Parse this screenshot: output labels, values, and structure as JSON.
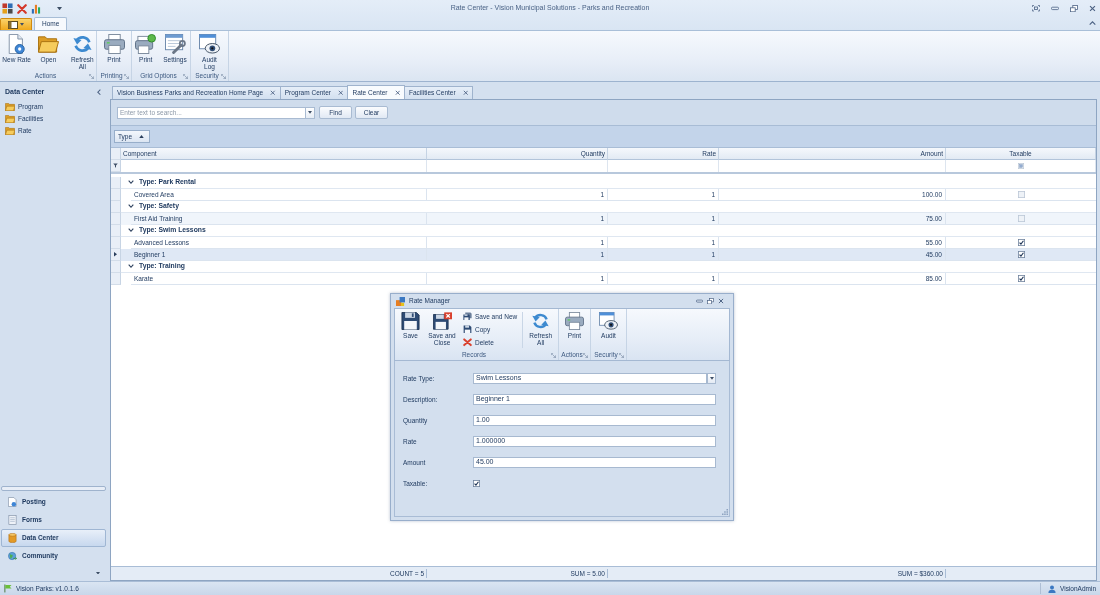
{
  "window": {
    "title": "Rate Center - Vision Municipal Solutions - Parks and Recreation"
  },
  "ribbon": {
    "tabs": [
      {
        "label": "Home",
        "selected": true
      }
    ],
    "groups": [
      {
        "label": "Actions",
        "buttons": [
          {
            "label": "New Rate"
          },
          {
            "label": "Open"
          },
          {
            "label": "Refresh All"
          }
        ]
      },
      {
        "label": "Printing",
        "buttons": [
          {
            "label": "Print"
          }
        ]
      },
      {
        "label": "Grid Options",
        "buttons": [
          {
            "label": "Print"
          },
          {
            "label": "Settings"
          }
        ]
      },
      {
        "label": "Security",
        "buttons": [
          {
            "label": "Audit Log"
          }
        ]
      }
    ]
  },
  "sidebar": {
    "title": "Data Center",
    "items": [
      {
        "label": "Program"
      },
      {
        "label": "Facilities"
      },
      {
        "label": "Rate"
      }
    ],
    "nav": [
      {
        "label": "Posting",
        "selected": false
      },
      {
        "label": "Forms",
        "selected": false
      },
      {
        "label": "Data Center",
        "selected": true
      },
      {
        "label": "Community",
        "selected": false
      }
    ]
  },
  "document_tabs": [
    {
      "label": "Vision Business Parks and Recreation Home Page",
      "selected": false
    },
    {
      "label": "Program Center",
      "selected": false
    },
    {
      "label": "Rate Center",
      "selected": true
    },
    {
      "label": "Facilities Center",
      "selected": false
    }
  ],
  "search": {
    "placeholder": "Enter text to search...",
    "buttons": [
      "Find",
      "Clear"
    ]
  },
  "group_panel": {
    "columns": [
      {
        "label": "Type",
        "ascending": true
      }
    ]
  },
  "grid": {
    "columns": [
      "Component",
      "Quantity",
      "Rate",
      "Amount",
      "Taxable"
    ],
    "filter_row": {
      "taxable_indeterminate": true
    },
    "groups": [
      {
        "label": "Type: Park Rental",
        "expanded": true,
        "rows": [
          {
            "component": "Covered Area",
            "quantity": "1",
            "rate": "1",
            "amount": "100.00",
            "taxable": false,
            "selected": false
          }
        ]
      },
      {
        "label": "Type: Safety",
        "expanded": true,
        "rows": [
          {
            "component": "First Aid Training",
            "quantity": "1",
            "rate": "1",
            "amount": "75.00",
            "taxable": false,
            "selected": false
          }
        ]
      },
      {
        "label": "Type: Swim Lessons",
        "expanded": true,
        "rows": [
          {
            "component": "Advanced Lessons",
            "quantity": "1",
            "rate": "1",
            "amount": "55.00",
            "taxable": true,
            "selected": false
          },
          {
            "component": "Beginner 1",
            "quantity": "1",
            "rate": "1",
            "amount": "45.00",
            "taxable": true,
            "selected": true
          }
        ]
      },
      {
        "label": "Type: Training",
        "expanded": true,
        "rows": [
          {
            "component": "Karate",
            "quantity": "1",
            "rate": "1",
            "amount": "85.00",
            "taxable": true,
            "selected": false
          }
        ]
      }
    ],
    "summary": [
      "COUNT = 5",
      "SUM = 5.00",
      "SUM = $360.00"
    ]
  },
  "dialog": {
    "title": "Rate Manager",
    "ribbon_groups": [
      {
        "label": "Records",
        "buttons": [
          {
            "label": "Save",
            "kind": "large"
          },
          {
            "label": "Save and Close",
            "kind": "large"
          },
          {
            "label": "Save and New",
            "kind": "small"
          },
          {
            "label": "Copy",
            "kind": "small"
          },
          {
            "label": "Delete",
            "kind": "small"
          },
          {
            "label": "Refresh All",
            "kind": "large"
          }
        ]
      },
      {
        "label": "Actions",
        "buttons": [
          {
            "label": "Print",
            "kind": "large"
          }
        ]
      },
      {
        "label": "Security",
        "buttons": [
          {
            "label": "Audit",
            "kind": "large"
          }
        ]
      }
    ],
    "fields": [
      {
        "label": "Rate Type:",
        "kind": "dropdown",
        "value": "Swim Lessons"
      },
      {
        "label": "Description:",
        "kind": "text",
        "value": "Beginner 1"
      },
      {
        "label": "Quantity",
        "kind": "text",
        "value": "1.00"
      },
      {
        "label": "Rate",
        "kind": "text",
        "value": "1.000000"
      },
      {
        "label": "Amount",
        "kind": "text",
        "value": "45.00"
      },
      {
        "label": "Taxable:",
        "kind": "checkbox",
        "checked": true
      }
    ]
  },
  "status_bar": {
    "version": "Vision Parks: v1.0.1.6",
    "user": "VisionAdmin"
  }
}
